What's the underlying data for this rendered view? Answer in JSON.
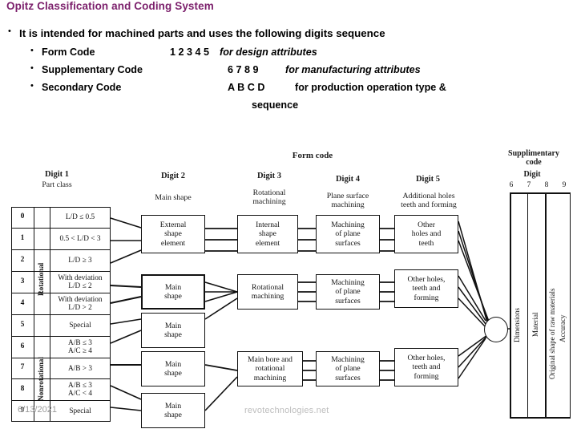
{
  "slide": {
    "title": "Opitz Classification and Coding System",
    "bullets": [
      {
        "level": 1,
        "text": "It is intended for machined parts and uses the following digits sequence"
      }
    ],
    "codes": [
      {
        "label": "Form Code",
        "digits": "1 2 3 4 5",
        "note": "for design attributes",
        "note_italic": true
      },
      {
        "label": "Supplementary Code",
        "digits": "6 7 8 9",
        "note": "for manufacturing attributes",
        "note_italic": true
      },
      {
        "label": "Secondary Code",
        "digits": "A B C D",
        "note": "for production operation type &",
        "note_italic": false
      }
    ],
    "continuation": "sequence",
    "title_color": "#7B1F6B"
  },
  "diagram": {
    "form_code_label": "Form code",
    "columns": [
      {
        "id": "digit1",
        "digit": "Digit 1",
        "heading": "Part class"
      },
      {
        "id": "digit2",
        "digit": "Digit 2",
        "heading": "Main shape"
      },
      {
        "id": "digit3",
        "digit": "Digit 3",
        "heading": "Rotational\nmachining"
      },
      {
        "id": "digit4",
        "digit": "Digit 4",
        "heading": "Plane surface\nmachining"
      },
      {
        "id": "digit5",
        "digit": "Digit 5",
        "heading": "Additional holes\nteeth and forming"
      }
    ],
    "part_class": {
      "group_rotational": "Rotational",
      "group_nonrotational": "Nonrotational",
      "rows": [
        {
          "num": "0",
          "text": "L/D ≤ 0.5"
        },
        {
          "num": "1",
          "text": "0.5 < L/D < 3"
        },
        {
          "num": "2",
          "text": "L/D ≥ 3"
        },
        {
          "num": "3",
          "text": "With deviation\nL/D ≤ 2"
        },
        {
          "num": "4",
          "text": "With deviation\nL/D > 2"
        },
        {
          "num": "5",
          "text": "Special"
        },
        {
          "num": "6",
          "text": "A/B ≤ 3\nA/C ≥ 4"
        },
        {
          "num": "7",
          "text": "A/B > 3"
        },
        {
          "num": "8",
          "text": "A/B ≤ 3\nA/C < 4"
        },
        {
          "num": "9",
          "text": "Special"
        }
      ]
    },
    "digit2_boxes": [
      "External\nshape\nelement",
      "Main\nshape",
      "Main\nshape",
      "Main\nshape",
      "Main\nshape"
    ],
    "digit3_boxes": [
      "Internal\nshape\nelement",
      "Rotational\nmachining",
      "Main bore and\nrotational\nmachining"
    ],
    "digit4_boxes": [
      "Machining\nof plane\nsurfaces",
      "Machining\nof plane\nsurfaces",
      "Machining\nof plane\nsurfaces"
    ],
    "digit5_boxes": [
      "Other\nholes and\nteeth",
      "Other holes,\nteeth and\nforming",
      "Other holes,\nteeth and\nforming"
    ],
    "supplementary": {
      "title": "Supplimentary\ncode",
      "digit_label": "Digit",
      "digits": [
        "6",
        "7",
        "8",
        "9"
      ],
      "attributes": [
        "Dimensions",
        "Material",
        "Original shape of raw materials",
        "Accuracy"
      ]
    }
  },
  "footer": {
    "date_stamp": "6/13/2021",
    "watermark": "revotechnologies.net"
  }
}
